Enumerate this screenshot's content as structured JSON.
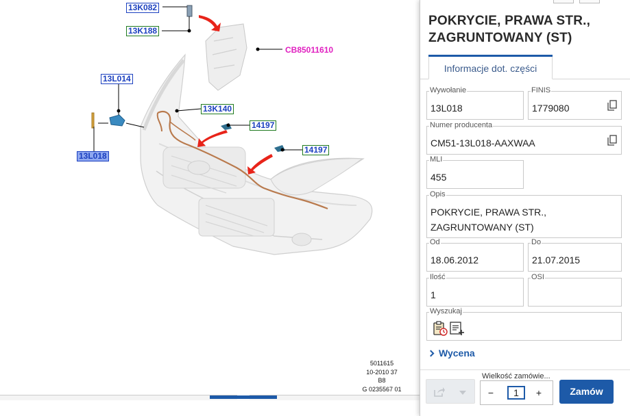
{
  "diagram": {
    "callouts": [
      {
        "id": "13K082",
        "label": "13K082"
      },
      {
        "id": "13K188",
        "label": "13K188"
      },
      {
        "id": "13L014",
        "label": "13L014"
      },
      {
        "id": "13K140",
        "label": "13K140"
      },
      {
        "id": "14197a",
        "label": "14197"
      },
      {
        "id": "14197b",
        "label": "14197"
      },
      {
        "id": "13L018",
        "label": "13L018"
      }
    ],
    "reference_label": "CB85011610",
    "stamp": [
      "5011615",
      "10-2010 37",
      "B8",
      "G 0235567 01"
    ]
  },
  "panel": {
    "title": "POKRYCIE, PRAWA STR., ZAGRUNTOWANY (ST)",
    "tab_label": "Informacje dot. części",
    "fields": {
      "wywolanie": {
        "label": "Wywołanie",
        "value": "13L018"
      },
      "finis": {
        "label": "FINIS",
        "value": "1779080"
      },
      "numer_producenta": {
        "label": "Numer producenta",
        "value": "CM51-13L018-AAXWAA"
      },
      "mli": {
        "label": "MLI",
        "value": "455"
      },
      "opis": {
        "label": "Opis",
        "value": "POKRYCIE, PRAWA STR.,\nZAGRUNTOWANY (ST)"
      },
      "od": {
        "label": "Od",
        "value": "18.06.2012"
      },
      "do": {
        "label": "Do",
        "value": "21.07.2015"
      },
      "ilosc": {
        "label": "Ilość",
        "value": "1"
      },
      "osi": {
        "label": "OSI",
        "value": ""
      },
      "wyszukaj": {
        "label": "Wyszukaj"
      }
    },
    "wycena_label": "Wycena",
    "footer": {
      "qty_label": "Wielkość zamówie...",
      "qty_minus": "−",
      "qty_plus": "+",
      "qty_value": "1",
      "order_label": "Zamów"
    }
  },
  "colors": {
    "accent": "#1d5aa8",
    "callout_blue": "#1a3fbf",
    "callout_green_border": "#1f7a1f",
    "selected_callout_bg": "#8fa8f0",
    "reference_magenta": "#e020c0",
    "arrow_red": "#e8241a",
    "harness_brown": "#b97a4d"
  },
  "icons": [
    "copy-icon",
    "clipboard-clock-icon",
    "list-add-icon",
    "share-icon",
    "chevron-down-icon",
    "chevron-right-icon"
  ]
}
